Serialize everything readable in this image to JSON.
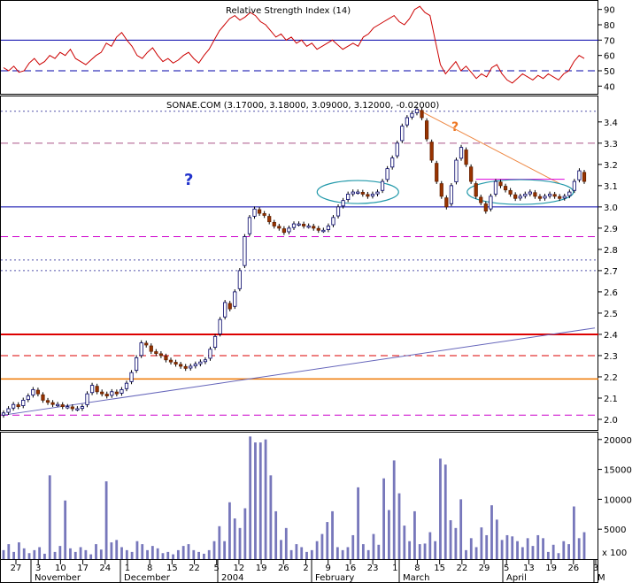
{
  "chart_data": [
    {
      "type": "line",
      "panel": "rsi",
      "title": "Relative Strength Index (14)",
      "ylim": [
        35,
        95
      ],
      "yticks": [
        40,
        50,
        60,
        70,
        80,
        90
      ],
      "reference_lines": [
        {
          "value": 70,
          "style": "solid",
          "color": "#0000aa"
        },
        {
          "value": 50,
          "style": "dashed",
          "color": "#0000aa"
        }
      ],
      "series": [
        {
          "name": "",
          "color": "#cc0000",
          "values": [
            52,
            50,
            53,
            49,
            50,
            55,
            58,
            54,
            56,
            60,
            58,
            62,
            60,
            64,
            58,
            56,
            54,
            57,
            60,
            62,
            68,
            66,
            72,
            75,
            70,
            66,
            60,
            58,
            62,
            65,
            60,
            56,
            58,
            55,
            57,
            60,
            62,
            58,
            55,
            60,
            64,
            70,
            76,
            80,
            84,
            86,
            83,
            85,
            88,
            86,
            82,
            80,
            76,
            72,
            74,
            70,
            72,
            68,
            70,
            66,
            68,
            64,
            66,
            68,
            70,
            67,
            64,
            66,
            68,
            66,
            72,
            74,
            78,
            80,
            82,
            84,
            86,
            82,
            80,
            84,
            90,
            92,
            88,
            86,
            70,
            54,
            48,
            52,
            56,
            50,
            53,
            49,
            45,
            48,
            46,
            52,
            54,
            48,
            44,
            42,
            45,
            48,
            46,
            44,
            47,
            45,
            48,
            46,
            44,
            48,
            50,
            56,
            60,
            58
          ]
        }
      ]
    },
    {
      "type": "candlestick",
      "panel": "price",
      "title": "SONAE.COM (3.17000, 3.18000, 3.09000, 3.12000, -0.02000)",
      "ylim": [
        1.95,
        3.52
      ],
      "yticks": [
        2.0,
        2.1,
        2.2,
        2.3,
        2.4,
        2.5,
        2.6,
        2.7,
        2.8,
        2.9,
        3.0,
        3.1,
        3.2,
        3.3,
        3.4
      ],
      "close": [
        2.03,
        2.05,
        2.07,
        2.06,
        2.09,
        2.11,
        2.14,
        2.12,
        2.09,
        2.08,
        2.07,
        2.07,
        2.06,
        2.06,
        2.05,
        2.05,
        2.06,
        2.12,
        2.16,
        2.13,
        2.12,
        2.11,
        2.13,
        2.12,
        2.14,
        2.17,
        2.22,
        2.29,
        2.36,
        2.35,
        2.32,
        2.31,
        2.3,
        2.28,
        2.27,
        2.26,
        2.25,
        2.24,
        2.25,
        2.26,
        2.27,
        2.28,
        2.33,
        2.39,
        2.47,
        2.55,
        2.52,
        2.6,
        2.7,
        2.86,
        2.95,
        2.99,
        2.97,
        2.96,
        2.93,
        2.91,
        2.9,
        2.88,
        2.9,
        2.92,
        2.92,
        2.91,
        2.91,
        2.9,
        2.89,
        2.89,
        2.91,
        2.95,
        3.0,
        3.03,
        3.06,
        3.07,
        3.07,
        3.06,
        3.05,
        3.06,
        3.07,
        3.12,
        3.18,
        3.23,
        3.3,
        3.38,
        3.42,
        3.44,
        3.46,
        3.42,
        3.32,
        3.22,
        3.12,
        3.05,
        3.0,
        3.1,
        3.22,
        3.28,
        3.2,
        3.12,
        3.05,
        3.02,
        2.98,
        3.05,
        3.12,
        3.1,
        3.08,
        3.06,
        3.04,
        3.05,
        3.06,
        3.07,
        3.05,
        3.04,
        3.05,
        3.06,
        3.05,
        3.04,
        3.05,
        3.07,
        3.12,
        3.17,
        3.12
      ],
      "annotations": [
        "?",
        "?"
      ],
      "horizontal_lines": [
        {
          "value": 3.45,
          "style": "dotted",
          "color": "#5555aa"
        },
        {
          "value": 3.3,
          "style": "dashed",
          "color": "#aa5588"
        },
        {
          "value": 3.0,
          "style": "solid",
          "color": "#0000aa"
        },
        {
          "value": 2.86,
          "style": "dashed",
          "color": "#cc00cc"
        },
        {
          "value": 2.75,
          "style": "dotted",
          "color": "#5555aa"
        },
        {
          "value": 2.7,
          "style": "dotted",
          "color": "#5555aa"
        },
        {
          "value": 2.4,
          "style": "solid",
          "color": "#dd0000"
        },
        {
          "value": 2.3,
          "style": "dashed",
          "color": "#dd0000"
        },
        {
          "value": 2.19,
          "style": "solid",
          "color": "#ee7700"
        },
        {
          "value": 2.02,
          "style": "dashed",
          "color": "#cc00cc"
        }
      ]
    },
    {
      "type": "bar",
      "panel": "volume",
      "ylim": [
        0,
        21000
      ],
      "yticks": [
        5000,
        10000,
        15000,
        20000
      ],
      "unit_label": "x 100",
      "color": "#7777bb",
      "values": [
        1500,
        2500,
        1200,
        2800,
        1800,
        1000,
        1500,
        2000,
        900,
        14000,
        1200,
        2200,
        9800,
        1800,
        1200,
        2000,
        1500,
        800,
        2500,
        1600,
        13000,
        2800,
        3200,
        2000,
        1500,
        1200,
        3000,
        2500,
        1500,
        2200,
        1800,
        1000,
        1200,
        800,
        1500,
        2200,
        2500,
        1500,
        1200,
        900,
        1500,
        3000,
        5500,
        3000,
        9500,
        6800,
        5200,
        8500,
        20500,
        19500,
        19500,
        20000,
        14000,
        8000,
        3200,
        5200,
        1500,
        2500,
        2000,
        1200,
        1500,
        3000,
        4200,
        6200,
        8000,
        2000,
        1500,
        2000,
        4000,
        12000,
        2500,
        1500,
        4200,
        2400,
        13500,
        8200,
        16500,
        11000,
        5600,
        3000,
        8000,
        2500,
        2600,
        4500,
        3000,
        16800,
        15800,
        6500,
        5200,
        10000,
        1500,
        3500,
        2000,
        5300,
        4000,
        9000,
        6600,
        3200,
        4000,
        3800,
        3000,
        2000,
        3500,
        2200,
        4000,
        3500,
        1200,
        2400,
        1000,
        3000,
        2500,
        8800,
        3500,
        4500
      ]
    }
  ],
  "x_axis": {
    "day_ticks": [
      "27",
      "3",
      "10",
      "17",
      "24",
      "1",
      "8",
      "15",
      "22",
      "5",
      "12",
      "19",
      "26",
      "2",
      "9",
      "16",
      "23",
      "1",
      "8",
      "15",
      "22",
      "29",
      "5",
      "13",
      "19",
      "26",
      "3"
    ],
    "month_labels": [
      "November",
      "December",
      "2004",
      "February",
      "March",
      "April",
      "M"
    ]
  }
}
